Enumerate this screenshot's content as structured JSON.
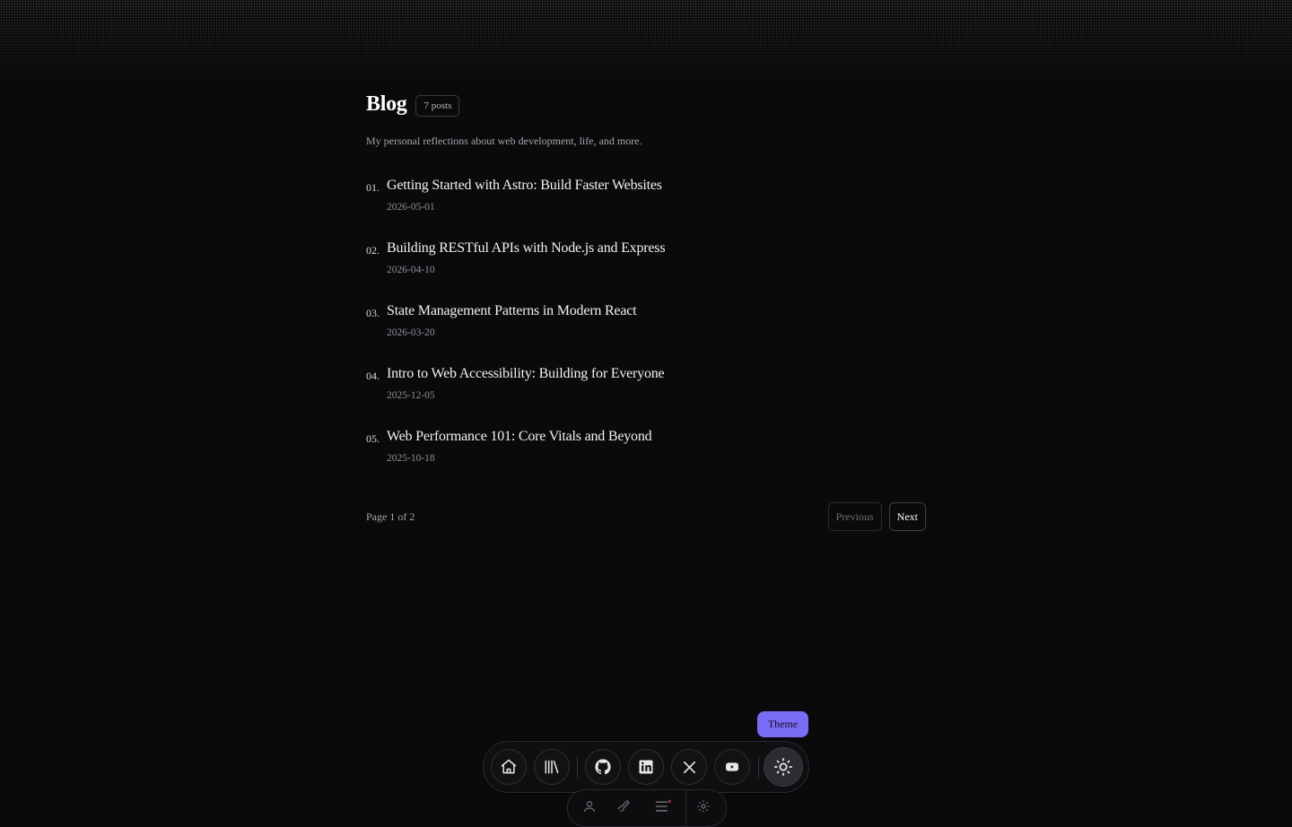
{
  "blog": {
    "title": "Blog",
    "count_badge": "7 posts",
    "subtitle": "My personal reflections about web development, life, and more."
  },
  "posts": [
    {
      "num": "01.",
      "title": "Getting Started with Astro: Build Faster Websites",
      "date": "2026-05-01"
    },
    {
      "num": "02.",
      "title": "Building RESTful APIs with Node.js and Express",
      "date": "2026-04-10"
    },
    {
      "num": "03.",
      "title": "State Management Patterns in Modern React",
      "date": "2026-03-20"
    },
    {
      "num": "04.",
      "title": "Intro to Web Accessibility: Building for Everyone",
      "date": "2025-12-05"
    },
    {
      "num": "05.",
      "title": "Web Performance 101: Core Vitals and Beyond",
      "date": "2025-10-18"
    }
  ],
  "pagination": {
    "info": "Page 1 of 2",
    "previous_label": "Previous",
    "next_label": "Next"
  },
  "dock": {
    "tooltip": "Theme",
    "items": [
      {
        "icon": "home-icon"
      },
      {
        "icon": "library-icon"
      },
      {
        "icon": "github-icon"
      },
      {
        "icon": "linkedin-icon"
      },
      {
        "icon": "x-icon"
      },
      {
        "icon": "youtube-icon"
      },
      {
        "icon": "sun-icon"
      }
    ],
    "accent_color": "#7b6cf6"
  }
}
